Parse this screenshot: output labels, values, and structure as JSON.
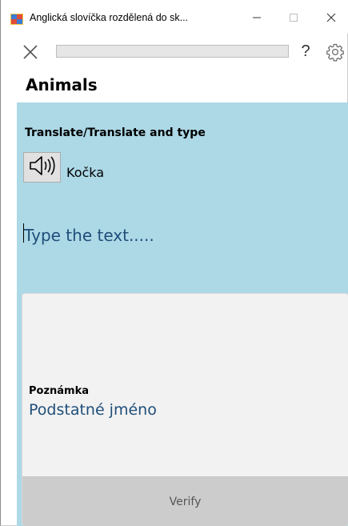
{
  "window": {
    "title": "Anglická slovíčka rozdělená do sk...",
    "icon": "app-icon"
  },
  "toolbar": {
    "progress_fraction": 0.0,
    "help_label": "?",
    "progress_color": "#06b025"
  },
  "lesson": {
    "title": "Animals",
    "mode_label": "Translate/Translate and type",
    "word": "Kočka",
    "speaker_icon": "speaker-icon"
  },
  "answer": {
    "value": "",
    "placeholder": "Type the text....."
  },
  "note": {
    "label": "Poznámka",
    "text": "Podstatné jméno"
  },
  "actions": {
    "verify_label": "Verify"
  },
  "colors": {
    "panel_bg": "#add8e6",
    "text_accent": "#1f4e79",
    "verify_bg": "#cccccc"
  }
}
